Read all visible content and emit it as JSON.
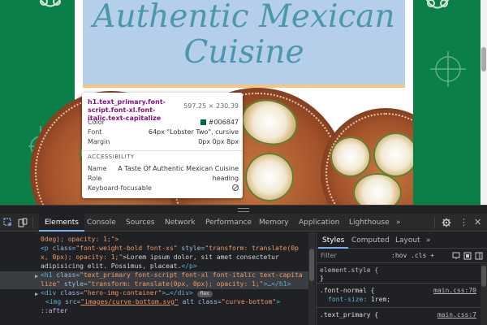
{
  "page": {
    "hero_title_line1": "Authentic Mexican",
    "hero_title_line2": "Cuisine"
  },
  "tooltip": {
    "selector": "h1.text_primary.font-script.font-xl.font-italic.text-capitalize",
    "size": "597.25 × 230.39",
    "rows": [
      {
        "key": "Color",
        "value": "#006847"
      },
      {
        "key": "Font",
        "value": "64px \"Lobster Two\", cursive"
      },
      {
        "key": "Margin",
        "value": "0px 0px 8px"
      }
    ],
    "accessibility_heading": "ACCESSIBILITY",
    "a11y_rows": [
      {
        "key": "Name",
        "value": "A Taste Of Authentic Mexican Cuisine"
      },
      {
        "key": "Role",
        "value": "heading"
      },
      {
        "key": "Keyboard-focusable",
        "value": ""
      }
    ],
    "color_swatch": "#006847"
  },
  "devtools": {
    "tabs": [
      "Elements",
      "Console",
      "Sources",
      "Network",
      "Performance",
      "Memory",
      "Application",
      "Lighthouse"
    ],
    "more_tabs": "»",
    "elements": {
      "line1": "0deg); opacity: 1;\">",
      "line2_tag": "<p",
      "line2_attr1": " class=",
      "line2_val1": "\"font-weight-bold font-xs\"",
      "line2_attr2": " style=",
      "line2_val2": "\"transform: translate(0p",
      "line3_val": "x, 0px); opacity: 1;\"",
      "line3_txt": ">Lorem ipsum dolor, sit amet consectetur",
      "line4_txt": "adipisicing elit. Possimus, placeat.",
      "line4_close": "</p>",
      "line5_tag": "<h1",
      "line5_attr1": " class=",
      "line5_val1": "\"text_primary font-script font-xl font-italic text-capita",
      "line6_val1": "lize\"",
      "line6_attr2": " style=",
      "line6_val2": "\"transform: translate(0px, 0px); opacity: 1;\"",
      "line6_close": ">…</h1>",
      "line7_tag": "<div",
      "line7_attr": " class=",
      "line7_val": "\"hero-img-container\"",
      "line7_close": ">…</div>",
      "line7_badge": "flex",
      "line8_tag": "<img",
      "line8_attr1": " src=",
      "line8_val1": "\"images/curve-bottom.svg\"",
      "line8_attr2": " alt class=",
      "line8_val2": "\"curve-bottom\"",
      "line8_close": ">",
      "line9": "::after"
    },
    "styles": {
      "tabs": [
        "Styles",
        "Computed",
        "Layout"
      ],
      "more": "»",
      "filter_placeholder": "Filter",
      "filter_buttons": ":hov  .cls  +",
      "rules": [
        {
          "selector": "element.style {",
          "source": "",
          "prop": "}",
          "value": ""
        },
        {
          "selector": ".font-normal {",
          "source": "main.css:70",
          "prop": "font-size:",
          "value": " 1rem;"
        },
        {
          "selector": ".text_primary {",
          "source": "main.css:7",
          "prop": "",
          "value": ""
        }
      ]
    }
  }
}
